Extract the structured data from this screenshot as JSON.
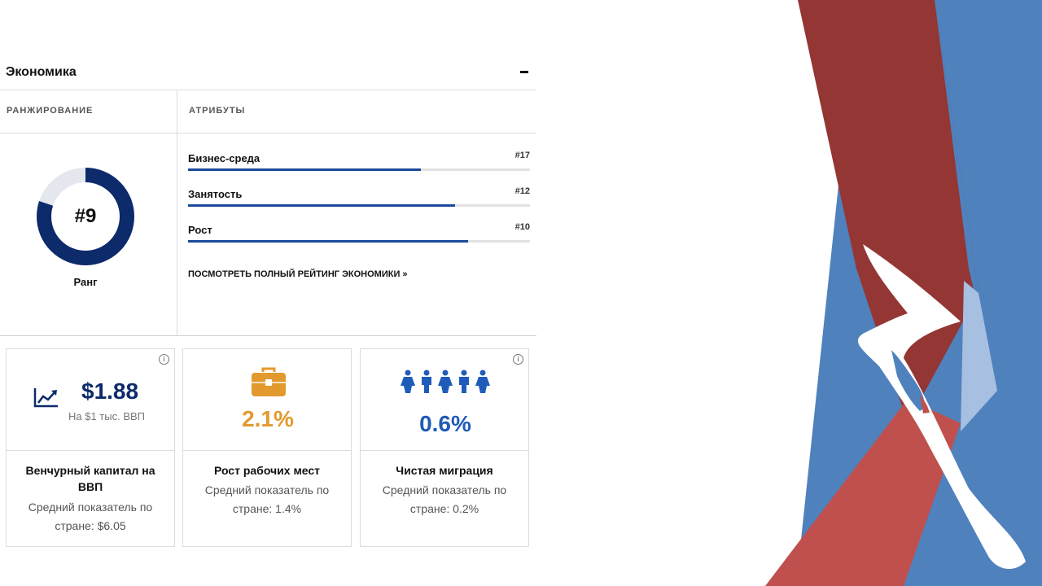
{
  "section": {
    "title": "Экономика",
    "collapse_symbol": "−"
  },
  "columns": {
    "ranking": "РАНЖИРОВАНИЕ",
    "attributes": "АТРИБУТЫ"
  },
  "rank": {
    "value": "#9",
    "caption": "Ранг",
    "fill_fraction": 0.8
  },
  "attributes": [
    {
      "label": "Бизнес-среда",
      "rank": "#17",
      "fill_fraction": 0.68
    },
    {
      "label": "Занятость",
      "rank": "#12",
      "fill_fraction": 0.78
    },
    {
      "label": "Рост",
      "rank": "#10",
      "fill_fraction": 0.82
    }
  ],
  "full_ranking_link": "ПОСМОТРЕТЬ ПОЛНЫЙ РЕЙТИНГ ЭКОНОМИКИ »",
  "cards": [
    {
      "value": "$1.88",
      "sub": "На $1 тыс. ВВП",
      "title_line1": "Венчурный капитал на",
      "title_line2": "ВВП",
      "desc_line1": "Средний показатель по",
      "desc_line2": "стране: $6.05",
      "icon": "trend-up-icon",
      "color": "#0d2a6b"
    },
    {
      "value": "2.1%",
      "title_line1": "Рост рабочих мест",
      "desc_line1": "Средний показатель по",
      "desc_line2": "стране: 1.4%",
      "icon": "briefcase-icon",
      "color": "#e29a2e"
    },
    {
      "value": "0.6%",
      "title_line1": "Чистая миграция",
      "desc_line1": "Средний показатель по",
      "desc_line2": "стране: 0.2%",
      "icon": "people-icon",
      "color": "#1f5bb8"
    }
  ],
  "info_symbol": "i",
  "colors": {
    "accent": "#1a4a9c",
    "donut": "#0d2a6b",
    "flag_red": "#c0504d",
    "flag_blue": "#4f81bd",
    "flag_darkred": "#943634"
  }
}
